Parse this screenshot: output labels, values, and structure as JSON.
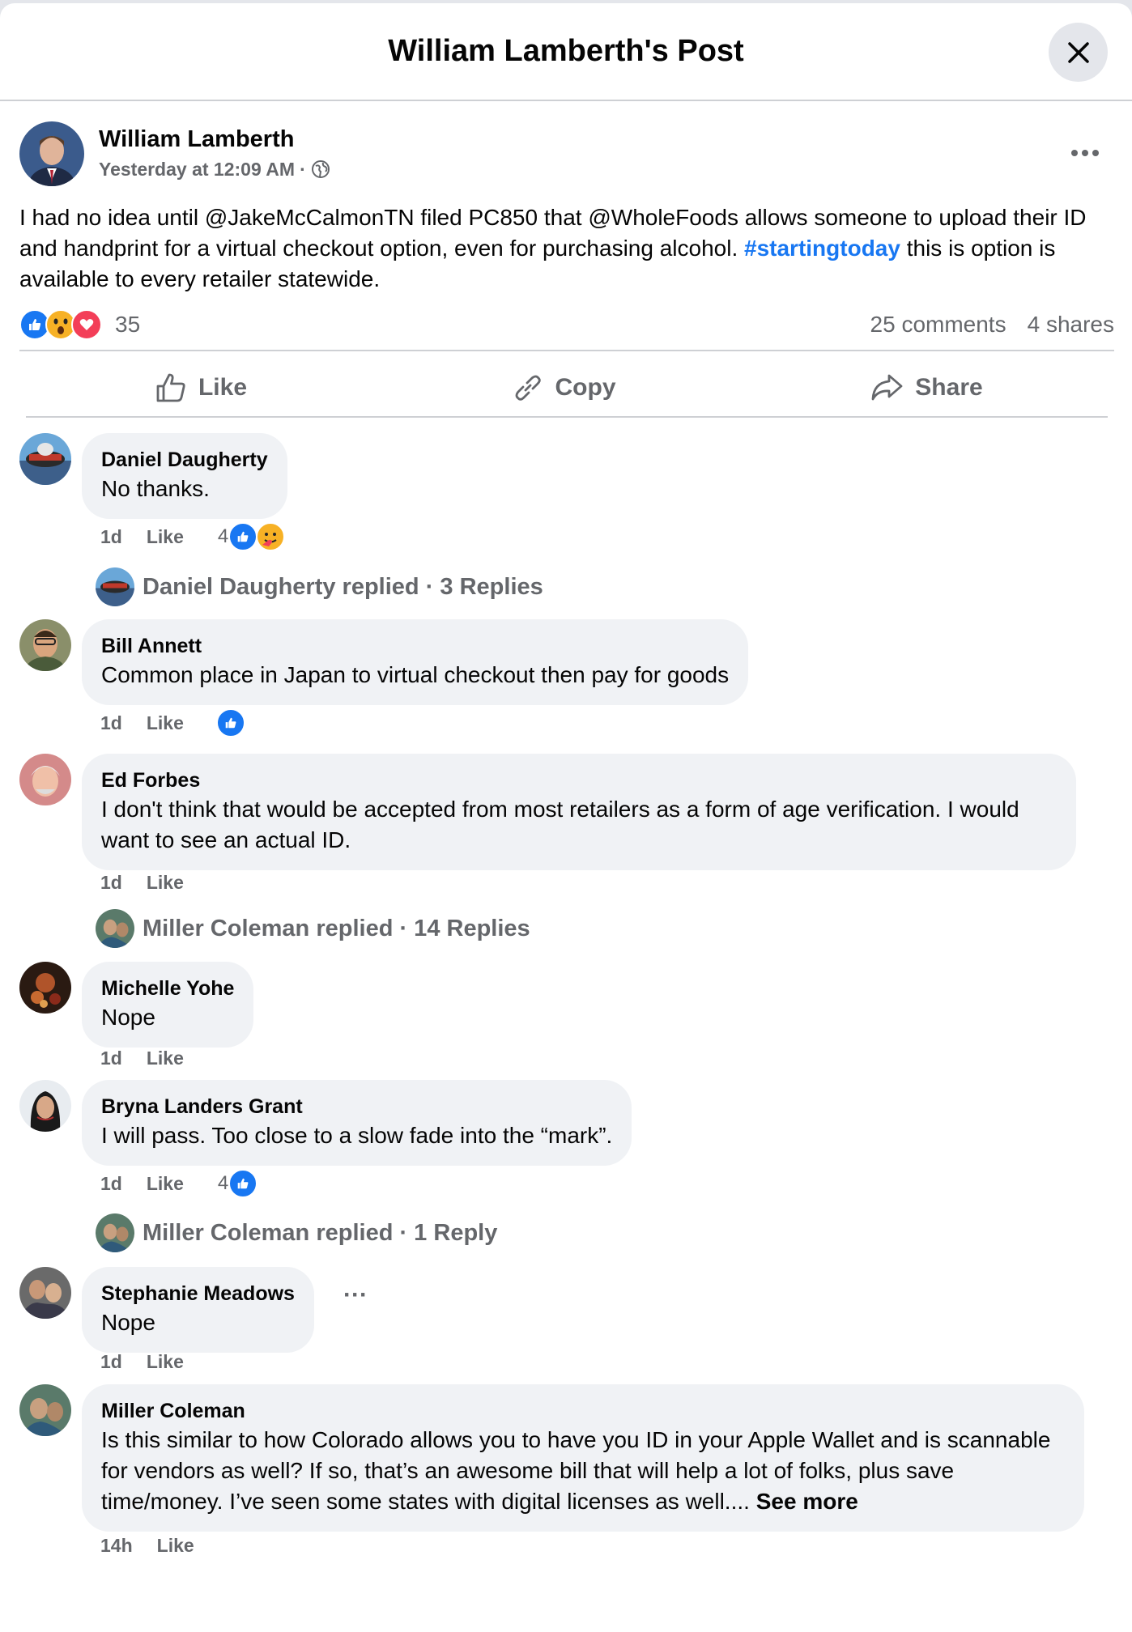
{
  "header": {
    "title": "William Lamberth's Post"
  },
  "post": {
    "author_name": "William Lamberth",
    "time": "Yesterday at 12:09 AM",
    "separator": "·",
    "text_main": "I had no idea until @JakeMcCalmonTN filed PC850 that @WholeFoods allows someone to upload their ID and handprint for a virtual checkout option, even for purchasing alcohol.",
    "hashtag": "#startingtoday",
    "text_tail": "this is option is available to every retailer statewide.",
    "reaction_count": "35",
    "comments_count": "25 comments",
    "shares_count": "4 shares",
    "reactions": [
      "like-icon",
      "wow-icon",
      "love-icon"
    ]
  },
  "actions": {
    "like": "Like",
    "copy": "Copy",
    "share": "Share"
  },
  "comments": [
    {
      "name": "Daniel Daugherty",
      "text": "No thanks.",
      "age": "1d",
      "like": "Like",
      "reaction_count": "4",
      "replies": "Daniel Daugherty replied · 3 Replies"
    },
    {
      "name": "Bill Annett",
      "text": "Common place in Japan to virtual checkout then pay for goods",
      "age": "1d",
      "like": "Like"
    },
    {
      "name": "Ed Forbes",
      "text": "I don't think that would be accepted from most retailers as a form of age verification. I would want to see an actual ID.",
      "age": "1d",
      "like": "Like",
      "replies": "Miller Coleman replied · 14 Replies"
    },
    {
      "name": "Michelle Yohe",
      "text": "Nope",
      "age": "1d",
      "like": "Like"
    },
    {
      "name": "Bryna Landers Grant",
      "text": "I will pass. Too close to a slow fade into the “mark”.",
      "age": "1d",
      "like": "Like",
      "reaction_count": "4",
      "replies": "Miller Coleman replied · 1 Reply"
    },
    {
      "name": "Stephanie Meadows",
      "text": "Nope",
      "age": "1d",
      "like": "Like",
      "more": "···"
    },
    {
      "name": "Miller Coleman",
      "text": "Is this similar to how Colorado allows you to have you ID in your Apple Wallet and is scannable for vendors as well? If so, that’s an awesome bill that will help a lot of folks, plus save time/money. I’ve seen some states with digital licenses as well....",
      "see_more": "See more",
      "age": "14h",
      "like": "Like"
    }
  ],
  "colors": {
    "accent": "#1877f2",
    "secondary_text": "#65676b",
    "bubble": "#f0f2f5",
    "love": "#f33e58",
    "wow": "#f7b125"
  }
}
